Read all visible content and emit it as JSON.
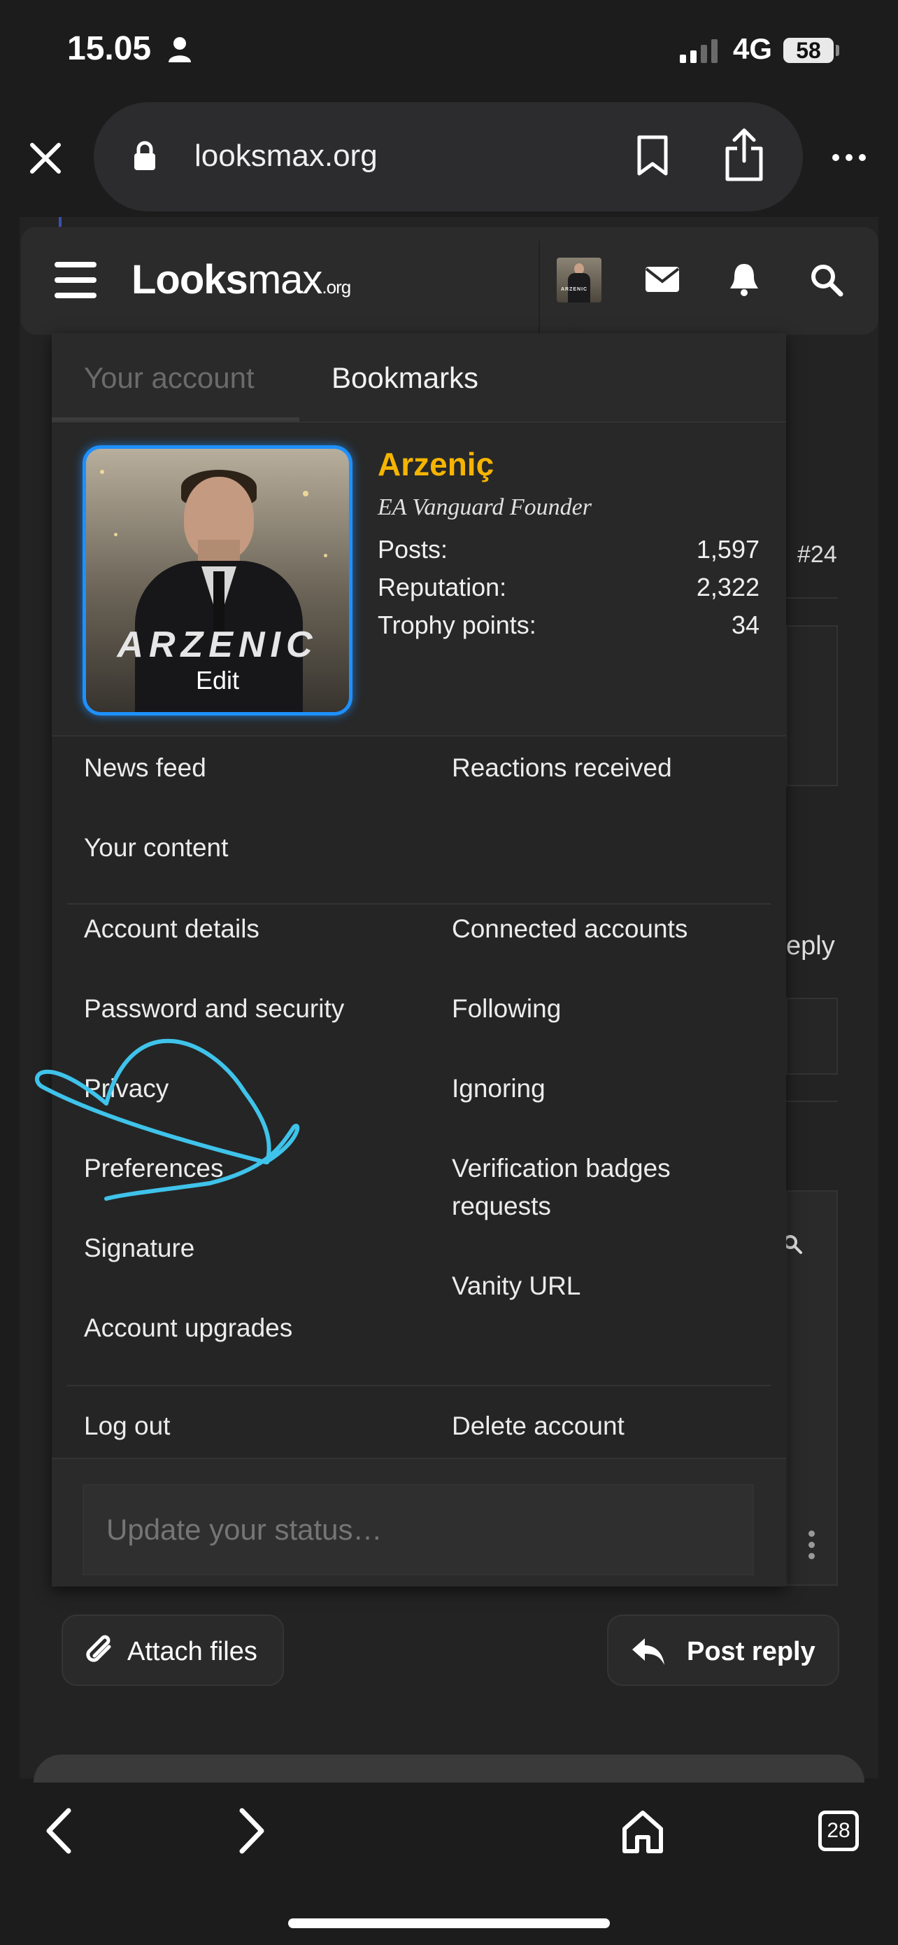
{
  "status_bar": {
    "time": "15.05",
    "network": "4G",
    "battery": "58"
  },
  "browser": {
    "url": "looksmax.org",
    "open_tabs": "28"
  },
  "site": {
    "logo_main": "Looks",
    "logo_light": "max",
    "logo_tld": ".org",
    "avatar_text": "ARZENIC"
  },
  "menu": {
    "tabs": [
      {
        "label": "Your account",
        "active": false
      },
      {
        "label": "Bookmarks",
        "active": true
      }
    ],
    "profile": {
      "avatar_brand": "ARZENIC",
      "edit_label": "Edit",
      "username": "Arzeniç",
      "user_title": "EA Vanguard Founder",
      "stats": [
        {
          "label": "Posts:",
          "value": "1,597"
        },
        {
          "label": "Reputation:",
          "value": "2,322"
        },
        {
          "label": "Trophy points:",
          "value": "34"
        }
      ]
    },
    "links": {
      "news_feed": "News feed",
      "reactions_received": "Reactions received",
      "your_content": "Your content",
      "account_details": "Account details",
      "connected_accounts": "Connected accounts",
      "password_security": "Password and security",
      "following": "Following",
      "privacy": "Privacy",
      "ignoring": "Ignoring",
      "preferences": "Preferences",
      "verification_badges": "Verification badges requests",
      "signature": "Signature",
      "vanity_url": "Vanity URL",
      "account_upgrades": "Account upgrades",
      "log_out": "Log out",
      "delete_account": "Delete account"
    },
    "status_placeholder": "Update your status…"
  },
  "background": {
    "post_number": "#24",
    "reply_fragment": "eply"
  },
  "actions": {
    "attach_label": "Attach files",
    "reply_label": "Post reply"
  },
  "colors": {
    "username": "#f5b400",
    "avatar_border": "#1e90ff",
    "annotation": "#3fc3ea"
  }
}
